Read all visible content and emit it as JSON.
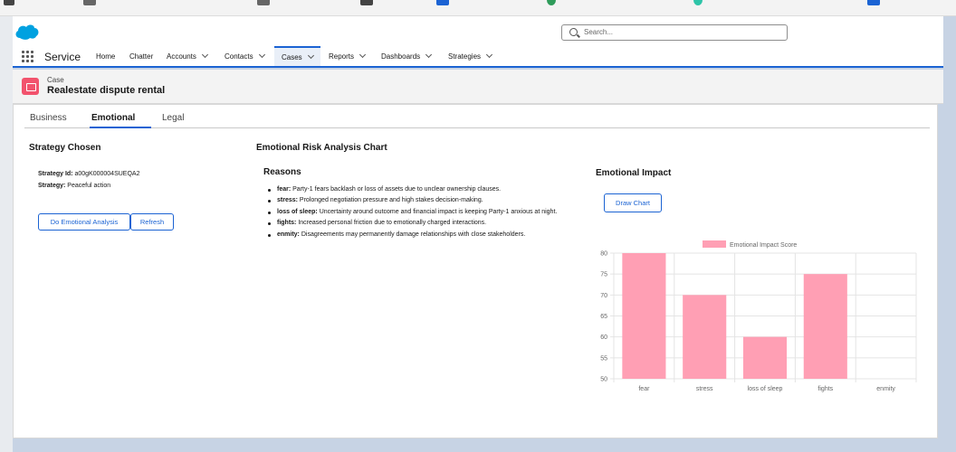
{
  "header": {
    "search_placeholder": "Search..."
  },
  "nav": {
    "app_name": "Service",
    "items": [
      {
        "label": "Home",
        "dropdown": false
      },
      {
        "label": "Chatter",
        "dropdown": false
      },
      {
        "label": "Accounts",
        "dropdown": true
      },
      {
        "label": "Contacts",
        "dropdown": true
      },
      {
        "label": "Cases",
        "dropdown": true,
        "active": true
      },
      {
        "label": "Reports",
        "dropdown": true
      },
      {
        "label": "Dashboards",
        "dropdown": true
      },
      {
        "label": "Strategies",
        "dropdown": true
      }
    ]
  },
  "record": {
    "object_label": "Case",
    "title": "Realestate dispute rental"
  },
  "tabs": [
    {
      "label": "Business"
    },
    {
      "label": "Emotional",
      "active": true
    },
    {
      "label": "Legal"
    }
  ],
  "strategy": {
    "heading": "Strategy Chosen",
    "id_label": "Strategy Id:",
    "id_value": "a00gK000004SUEQA2",
    "strategy_label": "Strategy:",
    "strategy_value": "Peaceful action",
    "analysis_button": "Do Emotional Analysis",
    "refresh_button": "Refresh"
  },
  "risk": {
    "heading": "Emotional Risk Analysis Chart",
    "reasons_heading": "Reasons",
    "reasons": [
      {
        "key": "fear:",
        "text": "Party-1 fears backlash or loss of assets due to unclear ownership clauses."
      },
      {
        "key": "stress:",
        "text": "Prolonged negotiation pressure and high stakes decision-making."
      },
      {
        "key": "loss of sleep:",
        "text": "Uncertainty around outcome and financial impact is keeping Party-1 anxious at night."
      },
      {
        "key": "fights:",
        "text": "Increased personal friction due to emotionally charged interactions."
      },
      {
        "key": "enmity:",
        "text": "Disagreements may permanently damage relationships with close stakeholders."
      }
    ]
  },
  "impact": {
    "heading": "Emotional Impact",
    "draw_button": "Draw Chart"
  },
  "chart_data": {
    "type": "bar",
    "categories": [
      "fear",
      "stress",
      "loss of sleep",
      "fights",
      "enmity"
    ],
    "series": [
      {
        "name": "Emotional Impact Score",
        "values": [
          80,
          70,
          60,
          75,
          null
        ],
        "color": "#ff9fb4"
      }
    ],
    "ylim": [
      50,
      80
    ],
    "yticks": [
      80,
      75,
      70,
      65,
      60,
      55,
      50
    ],
    "grid": true,
    "legend": "top"
  },
  "colors": {
    "brand": "#1b63d3",
    "case_icon": "#f2536d",
    "cloud": "#00a1e0"
  }
}
